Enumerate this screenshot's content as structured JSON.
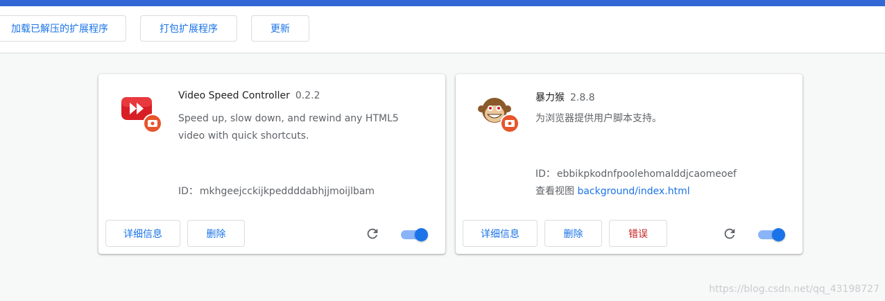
{
  "toolbar": {
    "load_unpacked": "加载已解压的扩展程序",
    "pack": "打包扩展程序",
    "update": "更新"
  },
  "extensions": [
    {
      "name": "Video Speed Controller",
      "version": "0.2.2",
      "description": "Speed up, slow down, and rewind any HTML5 video with quick shortcuts.",
      "id_label": "ID：",
      "id": "mkhgeejcckijkpeddddabhjjmoijlbam",
      "details_label": "详细信息",
      "remove_label": "删除",
      "enabled": true,
      "icon": "video-speed-controller-icon"
    },
    {
      "name": "暴力猴",
      "version": "2.8.8",
      "description": "为浏览器提供用户脚本支持。",
      "id_label": "ID：",
      "id": "ebbikpkodnfpoolehomalddjcaomeoef",
      "inspect_label": "查看视图",
      "inspect_link": "background/index.html",
      "details_label": "详细信息",
      "remove_label": "删除",
      "errors_label": "错误",
      "enabled": true,
      "icon": "violentmonkey-icon"
    }
  ],
  "watermark": "https://blog.csdn.net/qq_43198727",
  "colors": {
    "accent": "#1a73e8",
    "topbar": "#3367d6",
    "error": "#c5221f",
    "toggle_track": "#8ab4f8"
  }
}
